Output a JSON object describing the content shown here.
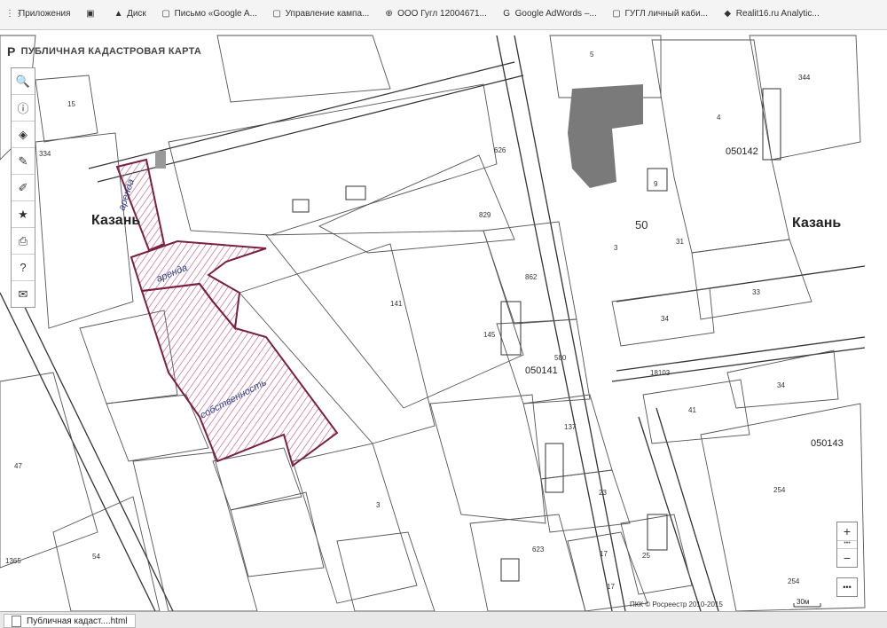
{
  "bookmarks": [
    {
      "icon": "apps-icon",
      "glyph": "⋮⋮",
      "label": "Приложения"
    },
    {
      "icon": "favicon",
      "glyph": "▣",
      "label": ""
    },
    {
      "icon": "drive-icon",
      "glyph": "▲",
      "label": "Диск"
    },
    {
      "icon": "page-icon",
      "glyph": "▢",
      "label": "Письмо «Google A..."
    },
    {
      "icon": "page-icon",
      "glyph": "▢",
      "label": "Управление кампа..."
    },
    {
      "icon": "globe-icon",
      "glyph": "⊕",
      "label": "ООО Гугл 12004671..."
    },
    {
      "icon": "google-icon",
      "glyph": "G",
      "label": "Google AdWords –..."
    },
    {
      "icon": "page-icon",
      "glyph": "▢",
      "label": "ГУГЛ личный каби..."
    },
    {
      "icon": "page-icon",
      "glyph": "◆",
      "label": "Realit16.ru Analytic..."
    }
  ],
  "brand": {
    "title": "ПУБЛИЧНАЯ КАДАСТРОВАЯ КАРТА",
    "logo": "P"
  },
  "toolbar": [
    {
      "name": "search-tool",
      "glyph": "🔍"
    },
    {
      "name": "info-tool",
      "glyph": "ⓘ"
    },
    {
      "name": "layers-tool",
      "glyph": "◈"
    },
    {
      "name": "draw-tool",
      "glyph": "✎"
    },
    {
      "name": "measure-tool",
      "glyph": "✐"
    },
    {
      "name": "favorites-tool",
      "glyph": "★"
    },
    {
      "name": "print-tool",
      "glyph": "⎙"
    },
    {
      "name": "help-tool",
      "glyph": "?"
    },
    {
      "name": "mail-tool",
      "glyph": "✉"
    }
  ],
  "cities": {
    "left": "Казань",
    "right": "Казань"
  },
  "blocks": [
    "050142",
    "050141",
    "050143"
  ],
  "parcels": [
    "15",
    "334",
    "626",
    "5",
    "344",
    "4",
    "50",
    "31",
    "3",
    "9",
    "829",
    "862",
    "141",
    "145",
    "580",
    "33",
    "34",
    "18103",
    "41",
    "34",
    "137",
    "23",
    "47",
    "54",
    "1365",
    "3",
    "17",
    "17",
    "25",
    "623",
    "254",
    "254"
  ],
  "annotations": {
    "arenda1": "аренда",
    "arenda2": "аренда",
    "ownership": "собственность"
  },
  "zoom": {
    "in": "+",
    "out": "−",
    "sep": "•••",
    "more": "•••"
  },
  "credit": "ПКК © Росреестр 2010-2015",
  "scale_label": "30м",
  "taskbar": {
    "tab": "Публичная кадаст....html"
  },
  "colors": {
    "hatch": "#b0305a",
    "building": "#7a7a7a",
    "line": "#333333"
  }
}
